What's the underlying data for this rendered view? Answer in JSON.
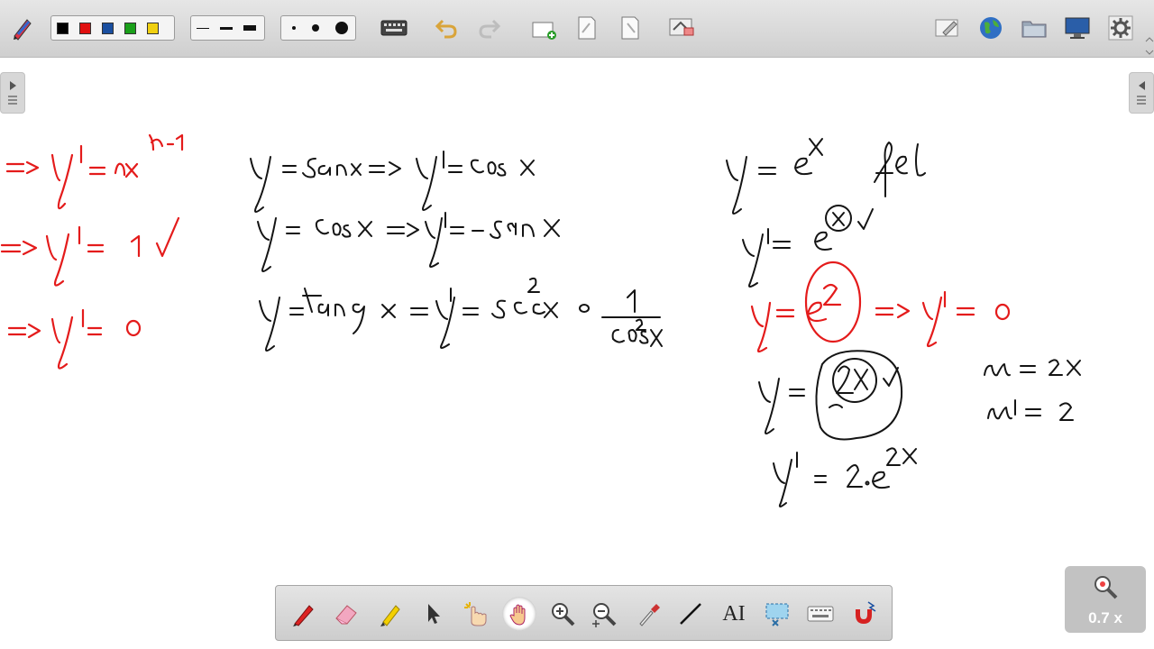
{
  "toolbar": {
    "colors": [
      "#000000",
      "#e01010",
      "#1a4fa0",
      "#1aa01a",
      "#f0d010"
    ],
    "line_widths": [
      "thin",
      "medium",
      "thick"
    ],
    "dot_sizes": [
      "small",
      "medium",
      "large"
    ],
    "buttons": [
      "keyboard-icon",
      "undo-icon",
      "redo-icon",
      "add-page-icon",
      "page-previous-icon",
      "page-next-icon",
      "clear-page-icon"
    ],
    "right_buttons": [
      "edit-icon",
      "globe-icon",
      "folder-icon",
      "display-icon",
      "settings-icon"
    ]
  },
  "bottom_tools": [
    "pen-icon",
    "eraser-icon",
    "highlighter-icon",
    "select-arrow-icon",
    "magic-pointer-icon",
    "pan-hand-icon",
    "zoom-in-icon",
    "zoom-out-icon",
    "pipette-icon",
    "line-icon",
    "text-tool-icon",
    "screen-capture-icon",
    "keyboard-icon",
    "magnet-icon"
  ],
  "text_tool_label": "AI",
  "zoom": {
    "label": "0.7 x"
  },
  "ink_colors": {
    "black": "#141414",
    "red": "#e41b1b"
  }
}
